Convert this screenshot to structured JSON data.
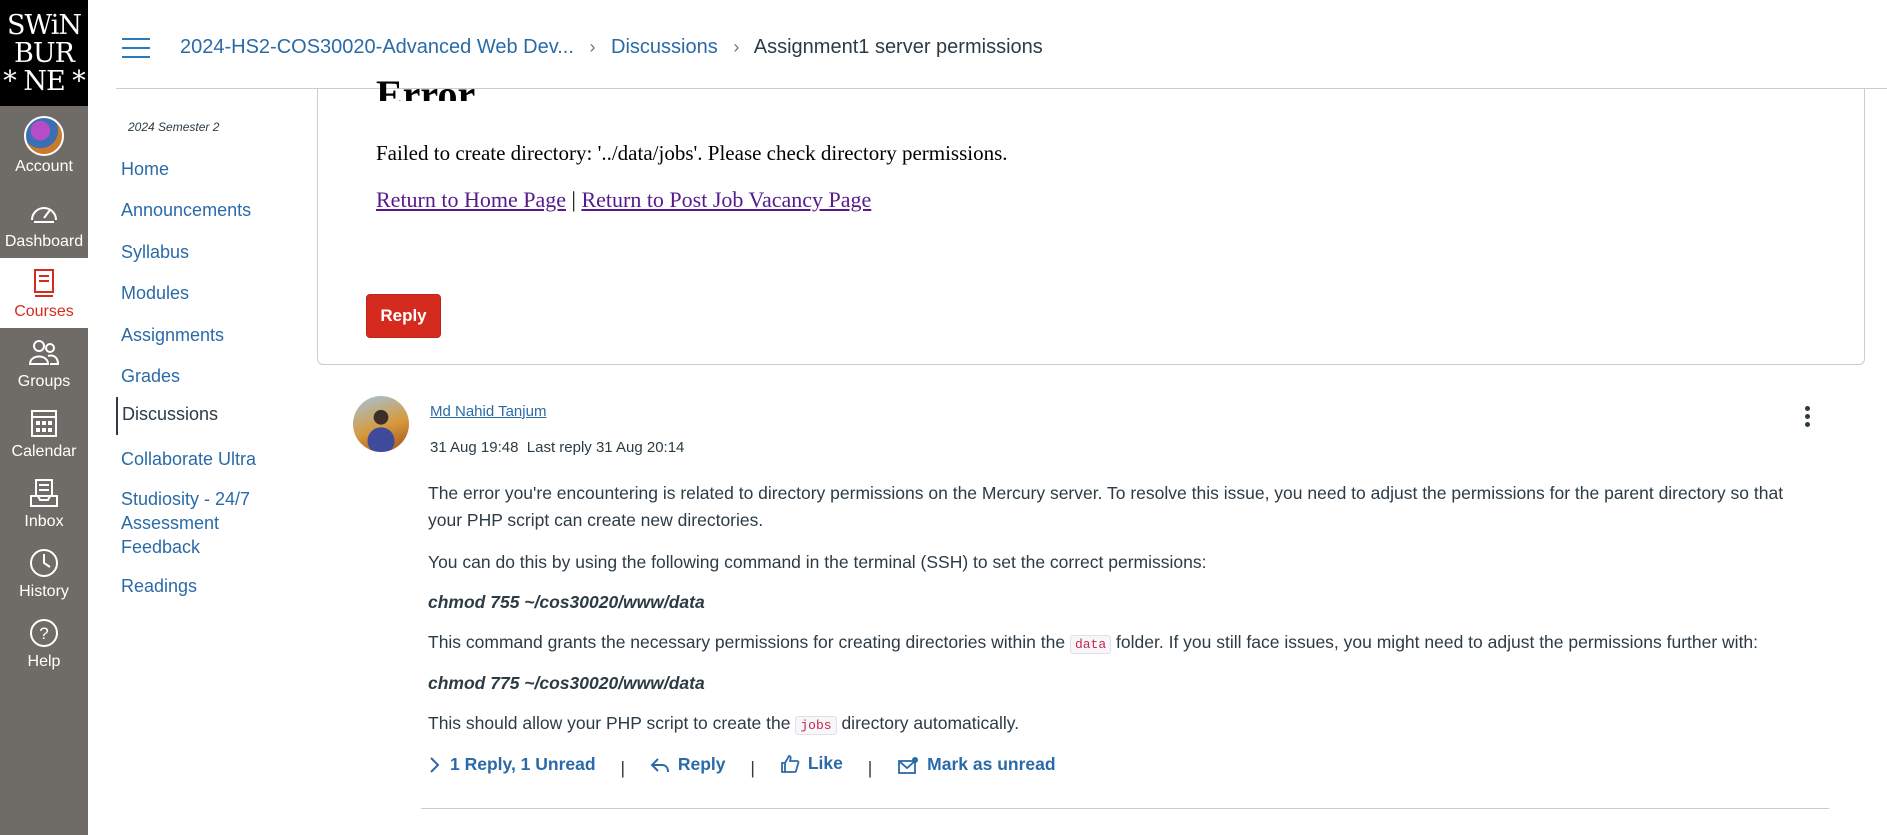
{
  "global_nav": {
    "logo_lines": [
      "SWiN",
      "BUR",
      "* NE *"
    ],
    "items": [
      {
        "label": "Account",
        "icon": "avatar"
      },
      {
        "label": "Dashboard",
        "icon": "dashboard-icon"
      },
      {
        "label": "Courses",
        "icon": "courses-icon",
        "active": true
      },
      {
        "label": "Groups",
        "icon": "groups-icon"
      },
      {
        "label": "Calendar",
        "icon": "calendar-icon"
      },
      {
        "label": "Inbox",
        "icon": "inbox-icon"
      },
      {
        "label": "History",
        "icon": "history-icon"
      },
      {
        "label": "Help",
        "icon": "help-icon"
      }
    ]
  },
  "header": {
    "crumbs": [
      {
        "label": "2024-HS2-COS30020-Advanced Web Dev..."
      },
      {
        "label": "Discussions"
      },
      {
        "label": "Assignment1 server permissions"
      }
    ]
  },
  "course_nav": {
    "term": "2024 Semester 2",
    "items": [
      {
        "label": "Home"
      },
      {
        "label": "Announcements"
      },
      {
        "label": "Syllabus"
      },
      {
        "label": "Modules"
      },
      {
        "label": "Assignments"
      },
      {
        "label": "Grades"
      },
      {
        "label": "Discussions",
        "active": true
      },
      {
        "label": "Collaborate Ultra"
      },
      {
        "label": "Studiosity - 24/7 Assessment Feedback"
      },
      {
        "label": "Readings"
      }
    ]
  },
  "error_card": {
    "heading": "Error",
    "message": "Failed to create directory: '../data/jobs'. Please check directory permissions.",
    "link_home": "Return to Home Page",
    "link_sep": "|",
    "link_post": "Return to Post Job Vacancy Page",
    "reply_label": "Reply"
  },
  "post": {
    "author": "Md Nahid Tanjum",
    "posted": "31 Aug 19:48",
    "last_reply": "Last reply 31 Aug 20:14",
    "p1": "The error you're encountering is related to directory permissions on the Mercury server. To resolve this issue, you need to adjust the permissions for the parent directory so that your PHP script can create new directories.",
    "p2": "You can do this by using the following command in the terminal (SSH) to set the correct permissions:",
    "cmd1": "chmod 755 ~/cos30020/www/data",
    "p3_before": "This command grants the necessary permissions for creating directories within the",
    "p3_code": "data",
    "p3_after": "folder. If you still face issues, you might need to adjust the permissions further with:",
    "cmd2": "chmod 775 ~/cos30020/www/data",
    "p4_before": "This should allow your PHP script to create the",
    "p4_code": "jobs",
    "p4_after": "directory automatically.",
    "actions": {
      "replies": "1 Reply, 1 Unread",
      "reply": "Reply",
      "like": "Like",
      "mark_unread": "Mark as unread"
    }
  },
  "colors": {
    "nav_bg": "#6f6c67",
    "link": "#2b6aa8",
    "brand_red": "#d52b1e"
  }
}
